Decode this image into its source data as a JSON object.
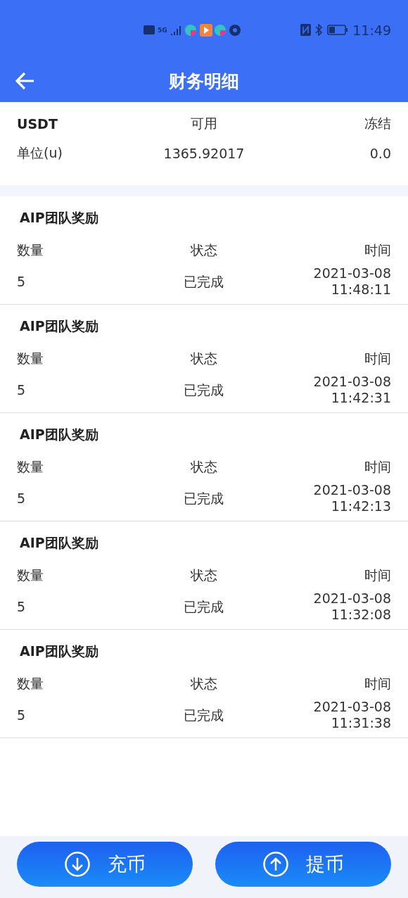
{
  "status_bar": {
    "time": "11:49",
    "network": "5G"
  },
  "header": {
    "title": "财务明细"
  },
  "summary": {
    "columns": [
      "USDT",
      "可用",
      "冻结"
    ],
    "values": [
      "单位(u)",
      "1365.92017",
      "0.0"
    ]
  },
  "records": [
    {
      "title": "AIP团队奖励",
      "labels": [
        "数量",
        "状态",
        "时间"
      ],
      "amount": "5",
      "status": "已完成",
      "date": "2021-03-08",
      "time": "11:48:11"
    },
    {
      "title": "AIP团队奖励",
      "labels": [
        "数量",
        "状态",
        "时间"
      ],
      "amount": "5",
      "status": "已完成",
      "date": "2021-03-08",
      "time": "11:42:31"
    },
    {
      "title": "AIP团队奖励",
      "labels": [
        "数量",
        "状态",
        "时间"
      ],
      "amount": "5",
      "status": "已完成",
      "date": "2021-03-08",
      "time": "11:42:13"
    },
    {
      "title": "AIP团队奖励",
      "labels": [
        "数量",
        "状态",
        "时间"
      ],
      "amount": "5",
      "status": "已完成",
      "date": "2021-03-08",
      "time": "11:32:08"
    },
    {
      "title": "AIP团队奖励",
      "labels": [
        "数量",
        "状态",
        "时间"
      ],
      "amount": "5",
      "status": "已完成",
      "date": "2021-03-08",
      "time": "11:31:38"
    }
  ],
  "actions": [
    {
      "label": "充币",
      "kind": "deposit"
    },
    {
      "label": "提币",
      "kind": "withdraw"
    }
  ]
}
